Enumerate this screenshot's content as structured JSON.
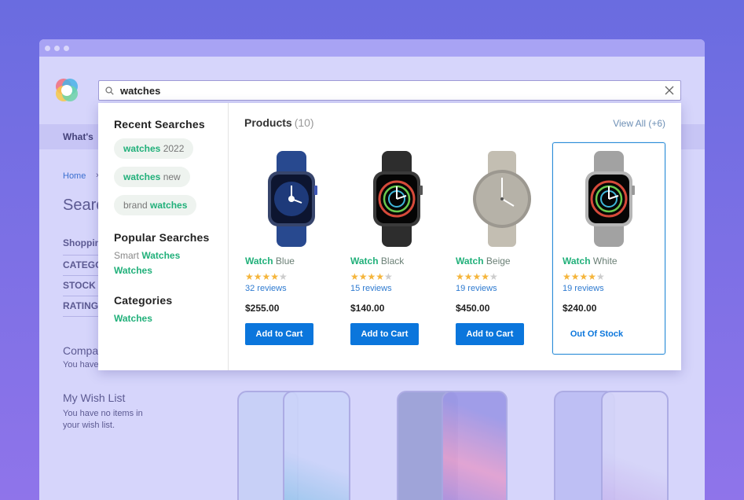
{
  "search": {
    "value": "watches"
  },
  "background": {
    "nav_item": "What's",
    "breadcrumb_home": "Home",
    "search_heading": "Searc",
    "filters": [
      "Shoppin",
      "CATEGO",
      "STOCK",
      "RATING"
    ],
    "compare_title": "Compa",
    "compare_text": "You have",
    "wishlist_title": "My Wish List",
    "wishlist_text_1": "You have no items in",
    "wishlist_text_2": "your wish list."
  },
  "dropdown": {
    "recent_title": "Recent Searches",
    "recent": [
      {
        "before": "",
        "match": "watches",
        "after": " 2022"
      },
      {
        "before": "",
        "match": "watches",
        "after": " new"
      },
      {
        "before": "brand ",
        "match": "watches",
        "after": ""
      }
    ],
    "popular_title": "Popular Searches",
    "popular": {
      "prefix": "Smart ",
      "match": "Watches",
      "second": "Watches"
    },
    "categories_title": "Categories",
    "categories": [
      "Watches"
    ],
    "products_title": "Products",
    "products_count": "(10)",
    "view_all": "View All (+6)",
    "products": [
      {
        "match": "Watch",
        "variant": " Blue",
        "rating": 4,
        "reviews": "32 reviews",
        "price": "$255.00",
        "action": "Add to Cart",
        "in_stock": true,
        "color": "#2c4f9e"
      },
      {
        "match": "Watch",
        "variant": " Black",
        "rating": 4,
        "reviews": "15 reviews",
        "price": "$140.00",
        "action": "Add to Cart",
        "in_stock": true,
        "color": "#2a2a2a"
      },
      {
        "match": "Watch",
        "variant": " Beige",
        "rating": 4,
        "reviews": "19 reviews",
        "price": "$450.00",
        "action": "Add to Cart",
        "in_stock": true,
        "color": "#bdb8ad"
      },
      {
        "match": "Watch",
        "variant": " White",
        "rating": 4,
        "reviews": "19 reviews",
        "price": "$240.00",
        "action": "Out Of Stock",
        "in_stock": false,
        "color": "#9c9c9c"
      }
    ]
  }
}
